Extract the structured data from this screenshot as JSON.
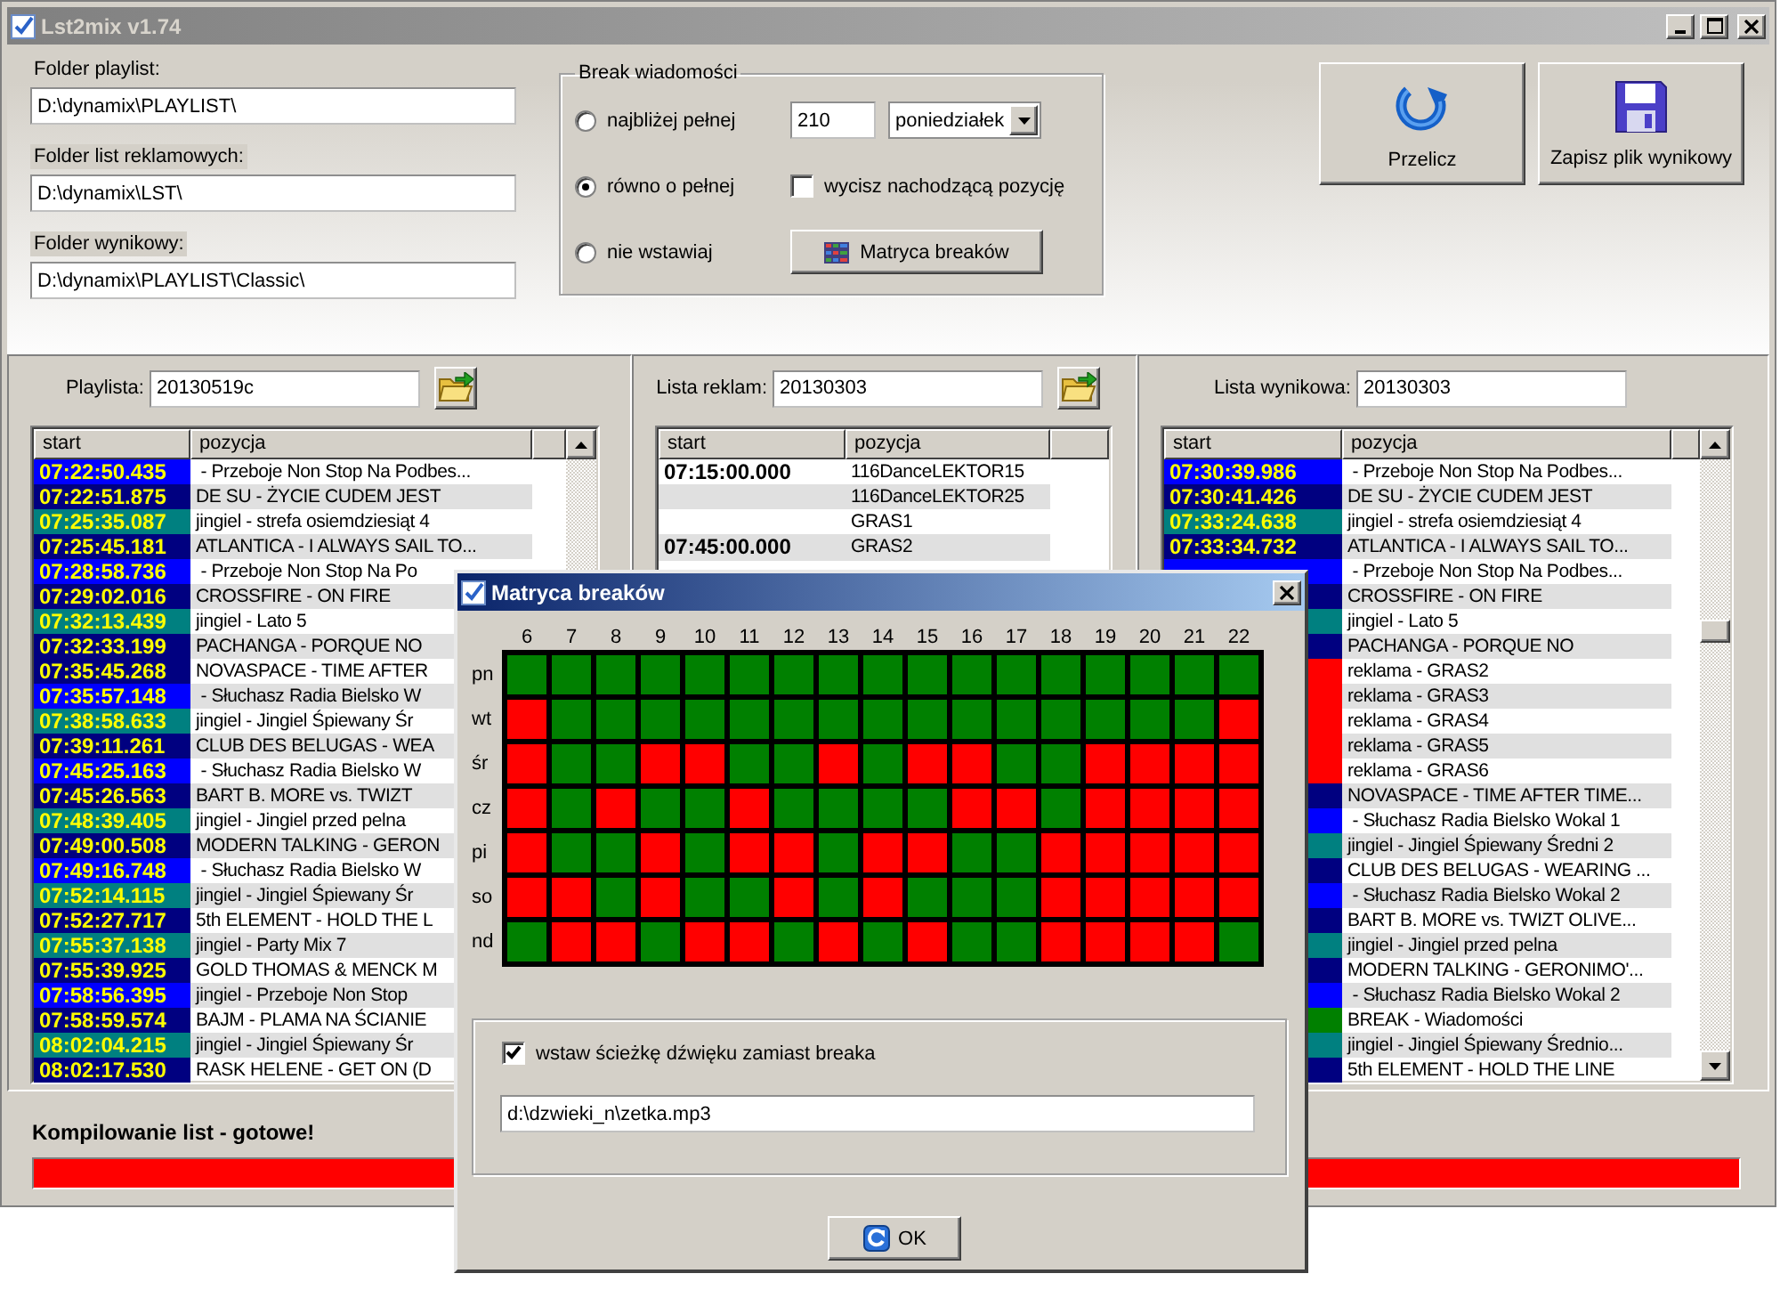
{
  "window": {
    "title": "Lst2mix v1.74"
  },
  "folders": [
    {
      "label": "Folder playlist:",
      "value": "D:\\dynamix\\PLAYLIST\\"
    },
    {
      "label": "Folder list reklamowych:",
      "value": "D:\\dynamix\\LST\\"
    },
    {
      "label": "Folder wynikowy:",
      "value": "D:\\dynamix\\PLAYLIST\\Classic\\"
    }
  ],
  "break_group": {
    "title": "Break wiadomości",
    "options": [
      {
        "label": "najbliżej pełnej",
        "selected": false
      },
      {
        "label": "równo o pełnej",
        "selected": true
      },
      {
        "label": "nie wstawiaj",
        "selected": false
      }
    ],
    "minutes": "210",
    "day": "poniedziałek",
    "mute_overlap": {
      "label": "wycisz nachodzącą pozycję",
      "checked": false
    },
    "matrix_button": "Matryca breaków"
  },
  "actions": [
    {
      "label": "Przelicz",
      "kind": "recalc"
    },
    {
      "label": "Zapisz plik wynikowy",
      "kind": "save"
    }
  ],
  "panels": [
    {
      "label": "Playlista:",
      "value": "20130519c",
      "open_button": true,
      "columns": [
        "start",
        "pozycja"
      ],
      "rows": [
        {
          "start": "07:22:50.435",
          "color": "#0000ff",
          "title": " - Przeboje Non Stop Na Podbes..."
        },
        {
          "start": "07:22:51.875",
          "color": "#000080",
          "title": "DE SU - ŻYCIE CUDEM JEST"
        },
        {
          "start": "07:25:35.087",
          "color": "#008080",
          "title": "jingiel - strefa osiemdziesiąt 4"
        },
        {
          "start": "07:25:45.181",
          "color": "#000080",
          "title": "ATLANTICA - I ALWAYS SAIL TO..."
        },
        {
          "start": "07:28:58.736",
          "color": "#0000ff",
          "title": " - Przeboje Non Stop Na Po"
        },
        {
          "start": "07:29:02.016",
          "color": "#000080",
          "title": "CROSSFIRE - ON FIRE"
        },
        {
          "start": "07:32:13.439",
          "color": "#008080",
          "title": "jingiel - Lato 5"
        },
        {
          "start": "07:32:33.199",
          "color": "#000080",
          "title": "PACHANGA - PORQUE NO"
        },
        {
          "start": "07:35:45.268",
          "color": "#000080",
          "title": "NOVASPACE - TIME AFTER"
        },
        {
          "start": "07:35:57.148",
          "color": "#0000ff",
          "title": " - Słuchasz Radia Bielsko W"
        },
        {
          "start": "07:38:58.633",
          "color": "#008080",
          "title": "jingiel - Jingiel Śpiewany Śr"
        },
        {
          "start": "07:39:11.261",
          "color": "#000080",
          "title": "CLUB DES BELUGAS - WEA"
        },
        {
          "start": "07:45:25.163",
          "color": "#0000ff",
          "title": " - Słuchasz Radia Bielsko W"
        },
        {
          "start": "07:45:26.563",
          "color": "#000080",
          "title": "BART B. MORE vs. TWIZT"
        },
        {
          "start": "07:48:39.405",
          "color": "#008080",
          "title": "jingiel - Jingiel przed pelna"
        },
        {
          "start": "07:49:00.508",
          "color": "#000080",
          "title": "MODERN TALKING - GERON"
        },
        {
          "start": "07:49:16.748",
          "color": "#0000ff",
          "title": " - Słuchasz Radia Bielsko W"
        },
        {
          "start": "07:52:14.115",
          "color": "#008080",
          "title": "jingiel - Jingiel Śpiewany Śr"
        },
        {
          "start": "07:52:27.717",
          "color": "#000080",
          "title": "5th ELEMENT - HOLD THE L"
        },
        {
          "start": "07:55:37.138",
          "color": "#008080",
          "title": "jingiel - Party Mix 7"
        },
        {
          "start": "07:55:39.925",
          "color": "#000080",
          "title": "GOLD THOMAS & MENCK M"
        },
        {
          "start": "07:58:56.395",
          "color": "#0000ff",
          "title": "jingiel - Przeboje Non Stop"
        },
        {
          "start": "07:58:59.574",
          "color": "#000080",
          "title": "BAJM - PLAMA NA ŚCIANIE"
        },
        {
          "start": "08:02:04.215",
          "color": "#008080",
          "title": "jingiel - Jingiel Śpiewany Śr"
        },
        {
          "start": "08:02:17.530",
          "color": "#000080",
          "title": "RASK HELENE - GET ON (D"
        }
      ]
    },
    {
      "label": "Lista reklam:",
      "value": "20130303",
      "open_button": true,
      "columns": [
        "start",
        "pozycja"
      ],
      "rows": [
        {
          "start": "07:15:00.000",
          "title": "116DanceLEKTOR15"
        },
        {
          "title": "116DanceLEKTOR25"
        },
        {
          "title": "GRAS1"
        },
        {
          "start": "07:45:00.000",
          "title": "GRAS2"
        }
      ]
    },
    {
      "label": "Lista wynikowa:",
      "value": "20130303",
      "open_button": false,
      "columns": [
        "start",
        "pozycja"
      ],
      "rows": [
        {
          "start": "07:30:39.986",
          "color": "#0000ff",
          "title": " - Przeboje Non Stop Na Podbes..."
        },
        {
          "start": "07:30:41.426",
          "color": "#000080",
          "title": "DE SU - ŻYCIE CUDEM JEST"
        },
        {
          "start": "07:33:24.638",
          "color": "#008080",
          "title": "jingiel - strefa osiemdziesiąt 4"
        },
        {
          "start": "07:33:34.732",
          "color": "#000080",
          "title": "ATLANTICA - I ALWAYS SAIL TO..."
        },
        {
          "color": "#0000ff",
          "title": " - Przeboje Non Stop Na Podbes..."
        },
        {
          "color": "#000080",
          "title": "CROSSFIRE - ON FIRE"
        },
        {
          "color": "#008080",
          "title": "jingiel - Lato 5"
        },
        {
          "color": "#000080",
          "title": "PACHANGA - PORQUE NO"
        },
        {
          "color": "#ff0000",
          "title": "reklama - GRAS2"
        },
        {
          "color": "#ff0000",
          "title": "reklama - GRAS3"
        },
        {
          "color": "#ff0000",
          "title": "reklama - GRAS4"
        },
        {
          "color": "#ff0000",
          "title": "reklama - GRAS5"
        },
        {
          "color": "#ff0000",
          "title": "reklama - GRAS6"
        },
        {
          "color": "#000080",
          "title": "NOVASPACE - TIME AFTER TIME..."
        },
        {
          "color": "#0000ff",
          "title": " - Słuchasz Radia Bielsko Wokal 1"
        },
        {
          "color": "#008080",
          "title": "jingiel - Jingiel Śpiewany Średni 2"
        },
        {
          "color": "#000080",
          "title": "CLUB DES BELUGAS - WEARING ..."
        },
        {
          "color": "#0000ff",
          "title": " - Słuchasz Radia Bielsko Wokal 2"
        },
        {
          "color": "#000080",
          "title": "BART B. MORE vs. TWIZT OLIVE..."
        },
        {
          "color": "#008080",
          "title": "jingiel - Jingiel przed pelna"
        },
        {
          "color": "#000080",
          "title": "MODERN TALKING - GERONIMO'..."
        },
        {
          "color": "#0000ff",
          "title": " - Słuchasz Radia Bielsko Wokal 2"
        },
        {
          "color": "#008000",
          "title": "BREAK - Wiadomości"
        },
        {
          "color": "#008080",
          "title": "jingiel - Jingiel Śpiewany Średnio..."
        },
        {
          "color": "#000080",
          "title": "5th ELEMENT - HOLD THE LINE"
        }
      ]
    }
  ],
  "status": {
    "message": "Kompilowanie list - gotowe!",
    "level": 1
  },
  "break_matrix": {
    "title": "Matryca breaków",
    "hours": [
      "6",
      "7",
      "8",
      "9",
      "10",
      "11",
      "12",
      "13",
      "14",
      "15",
      "16",
      "17",
      "18",
      "19",
      "20",
      "21",
      "22"
    ],
    "days": [
      {
        "label": "pn",
        "cells": [
          true,
          true,
          true,
          true,
          true,
          true,
          true,
          true,
          true,
          true,
          true,
          true,
          true,
          true,
          true,
          true,
          true
        ]
      },
      {
        "label": "wt",
        "cells": [
          false,
          true,
          true,
          true,
          true,
          true,
          true,
          true,
          true,
          true,
          true,
          true,
          true,
          true,
          true,
          true,
          false
        ]
      },
      {
        "label": "śr",
        "cells": [
          false,
          true,
          true,
          false,
          false,
          true,
          true,
          false,
          true,
          false,
          false,
          true,
          true,
          false,
          false,
          false,
          false
        ]
      },
      {
        "label": "cz",
        "cells": [
          false,
          true,
          false,
          true,
          true,
          false,
          true,
          true,
          true,
          true,
          false,
          false,
          true,
          false,
          false,
          false,
          false
        ]
      },
      {
        "label": "pi",
        "cells": [
          false,
          true,
          true,
          false,
          true,
          false,
          false,
          true,
          false,
          false,
          true,
          true,
          false,
          false,
          false,
          false,
          false
        ]
      },
      {
        "label": "so",
        "cells": [
          false,
          false,
          true,
          false,
          true,
          true,
          false,
          true,
          false,
          true,
          true,
          true,
          false,
          false,
          false,
          false,
          false
        ]
      },
      {
        "label": "nd",
        "cells": [
          true,
          false,
          false,
          true,
          false,
          false,
          true,
          false,
          true,
          false,
          true,
          true,
          false,
          false,
          false,
          false,
          true
        ]
      }
    ],
    "insert_sound": {
      "label": "wstaw ścieżkę dźwięku zamiast breaka",
      "checked": true
    },
    "sound_path": "d:\\dzwieki_n\\zetka.mp3",
    "ok": "OK"
  }
}
